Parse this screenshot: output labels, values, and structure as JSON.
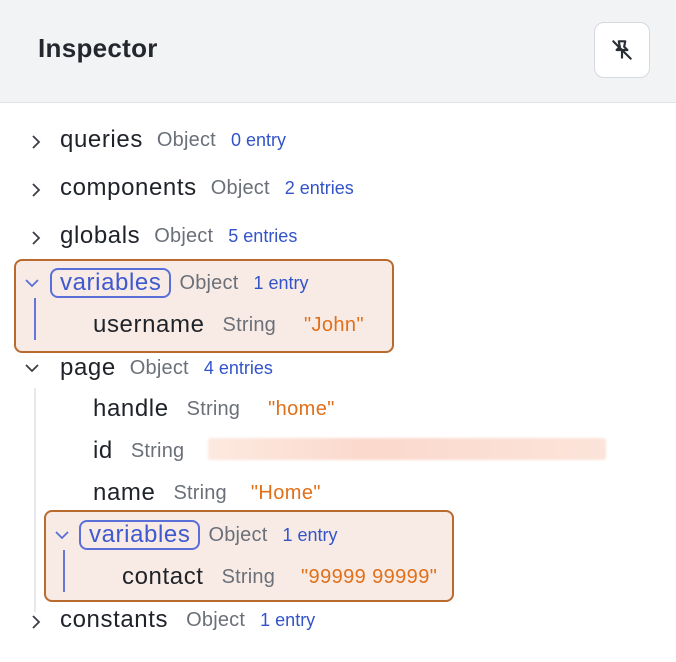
{
  "header": {
    "title": "Inspector",
    "pin_icon": "unpin-icon"
  },
  "tree": {
    "queries": {
      "key": "queries",
      "type": "Object",
      "count": "0 entry"
    },
    "components": {
      "key": "components",
      "type": "Object",
      "count": "2 entries"
    },
    "globals": {
      "key": "globals",
      "type": "Object",
      "count": "5 entries"
    },
    "variables": {
      "key": "variables",
      "type": "Object",
      "count": "1 entry",
      "children": [
        {
          "key": "username",
          "type": "String",
          "value": "\"John\""
        }
      ]
    },
    "page": {
      "key": "page",
      "type": "Object",
      "count": "4 entries",
      "children": [
        {
          "key": "handle",
          "type": "String",
          "value": "\"home\""
        },
        {
          "key": "id",
          "type": "String",
          "value": ""
        },
        {
          "key": "name",
          "type": "String",
          "value": "\"Home\""
        }
      ],
      "variables": {
        "key": "variables",
        "type": "Object",
        "count": "1 entry",
        "children": [
          {
            "key": "contact",
            "type": "String",
            "value": "\"99999 99999\""
          }
        ]
      }
    },
    "constants": {
      "key": "constants",
      "type": "Object",
      "count": "1 entry"
    }
  },
  "colors": {
    "highlight_border": "#b86a2f",
    "highlight_fill": "#f8ebe5",
    "chip_border": "#5a6fd8",
    "count_text": "#3354c9",
    "string_value": "#e0701a"
  }
}
